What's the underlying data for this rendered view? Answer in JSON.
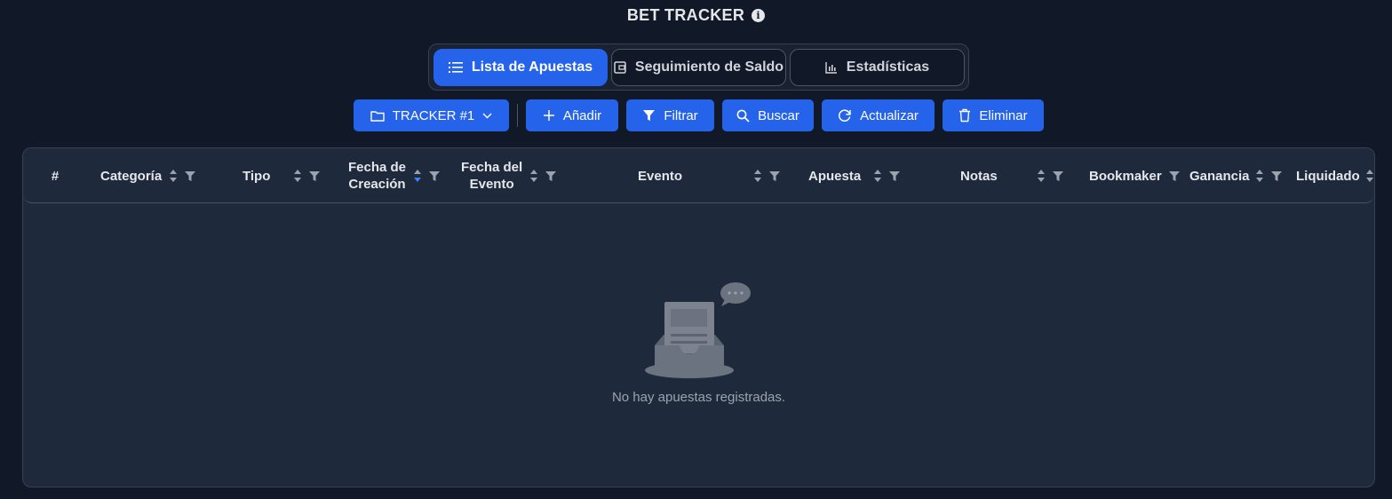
{
  "app": {
    "title": "BET TRACKER",
    "info_icon": "info-icon"
  },
  "tabs": [
    {
      "label": "Lista de Apuestas",
      "icon": "list-icon",
      "active": true
    },
    {
      "label": "Seguimiento de Saldo",
      "icon": "wallet-icon",
      "active": false
    },
    {
      "label": "Estadísticas",
      "icon": "bar-chart-icon",
      "active": false
    }
  ],
  "toolbar": {
    "tracker_label": "TRACKER #1",
    "add_label": "Añadir",
    "filter_label": "Filtrar",
    "search_label": "Buscar",
    "refresh_label": "Actualizar",
    "delete_label": "Eliminar"
  },
  "table": {
    "columns": [
      {
        "line1": "#",
        "line2": ""
      },
      {
        "line1": "Categoría",
        "line2": ""
      },
      {
        "line1": "Tipo",
        "line2": ""
      },
      {
        "line1": "Fecha de",
        "line2": "Creación"
      },
      {
        "line1": "Fecha del",
        "line2": "Evento"
      },
      {
        "line1": "Evento",
        "line2": ""
      },
      {
        "line1": "Apuesta",
        "line2": ""
      },
      {
        "line1": "Notas",
        "line2": ""
      },
      {
        "line1": "Bookmaker",
        "line2": ""
      },
      {
        "line1": "Ganancia",
        "line2": ""
      },
      {
        "line1": "Liquidado",
        "line2": ""
      }
    ],
    "active_sort_column": "Fecha de Creación",
    "empty_message": "No hay apuestas registradas."
  },
  "colors": {
    "accent": "#2563eb",
    "background": "#111827",
    "card": "#1e293b"
  }
}
